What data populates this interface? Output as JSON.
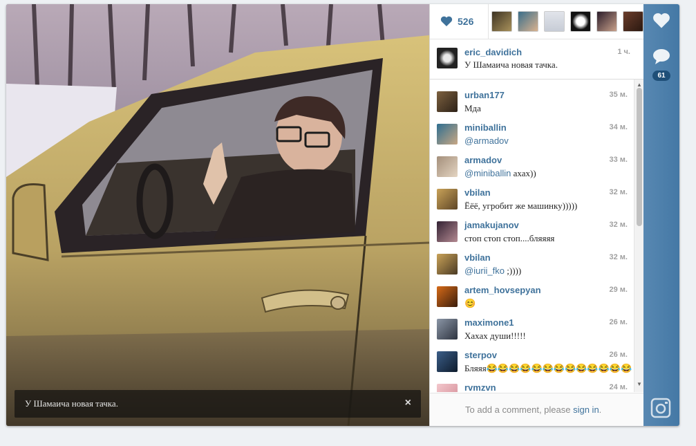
{
  "photo": {
    "caption": "У Шамаича новая тачка.",
    "close_symbol": "×"
  },
  "likes": {
    "count": "526",
    "avatar_count": 6
  },
  "owner": {
    "username": "eric_davidich",
    "time": "1 ч.",
    "caption": "У Шамаича новая тачка."
  },
  "comments": [
    {
      "username": "urban177",
      "time": "35 м.",
      "text": "Мда",
      "mention": ""
    },
    {
      "username": "miniballin",
      "time": "34 м.",
      "text": "",
      "mention": "@armadov"
    },
    {
      "username": "armadov",
      "time": "33 м.",
      "text": " ахах))",
      "mention": "@miniballin"
    },
    {
      "username": "vbilan",
      "time": "32 м.",
      "text": "Ёёё, угробит же машинку)))))",
      "mention": ""
    },
    {
      "username": "jamakujanov",
      "time": "32 м.",
      "text": "стоп стоп стоп....бляяяя",
      "mention": ""
    },
    {
      "username": "vbilan",
      "time": "32 м.",
      "text": " ;))))",
      "mention": "@iurii_fko"
    },
    {
      "username": "artem_hovsepyan",
      "time": "29 м.",
      "text": "😊",
      "mention": ""
    },
    {
      "username": "maximone1",
      "time": "26 м.",
      "text": "Хахах души!!!!!",
      "mention": ""
    },
    {
      "username": "sterpov",
      "time": "26 м.",
      "text": "Бляяя😂😂😂😂😂😂😂😂😂😂😂😂😂",
      "mention": ""
    },
    {
      "username": "rvmzvn",
      "time": "24 м.",
      "text": "",
      "mention": ""
    }
  ],
  "add_comment": {
    "prefix": "To add a comment, please ",
    "link": "sign in",
    "suffix": "."
  },
  "rail": {
    "comment_count": "61"
  },
  "colors": {
    "accent": "#3f729b",
    "rail": "#4a7eaa"
  },
  "icons": [
    "heart-icon",
    "speech-bubble-icon",
    "instagram-camera-icon",
    "close-icon",
    "scroll-up-icon",
    "scroll-down-icon"
  ]
}
